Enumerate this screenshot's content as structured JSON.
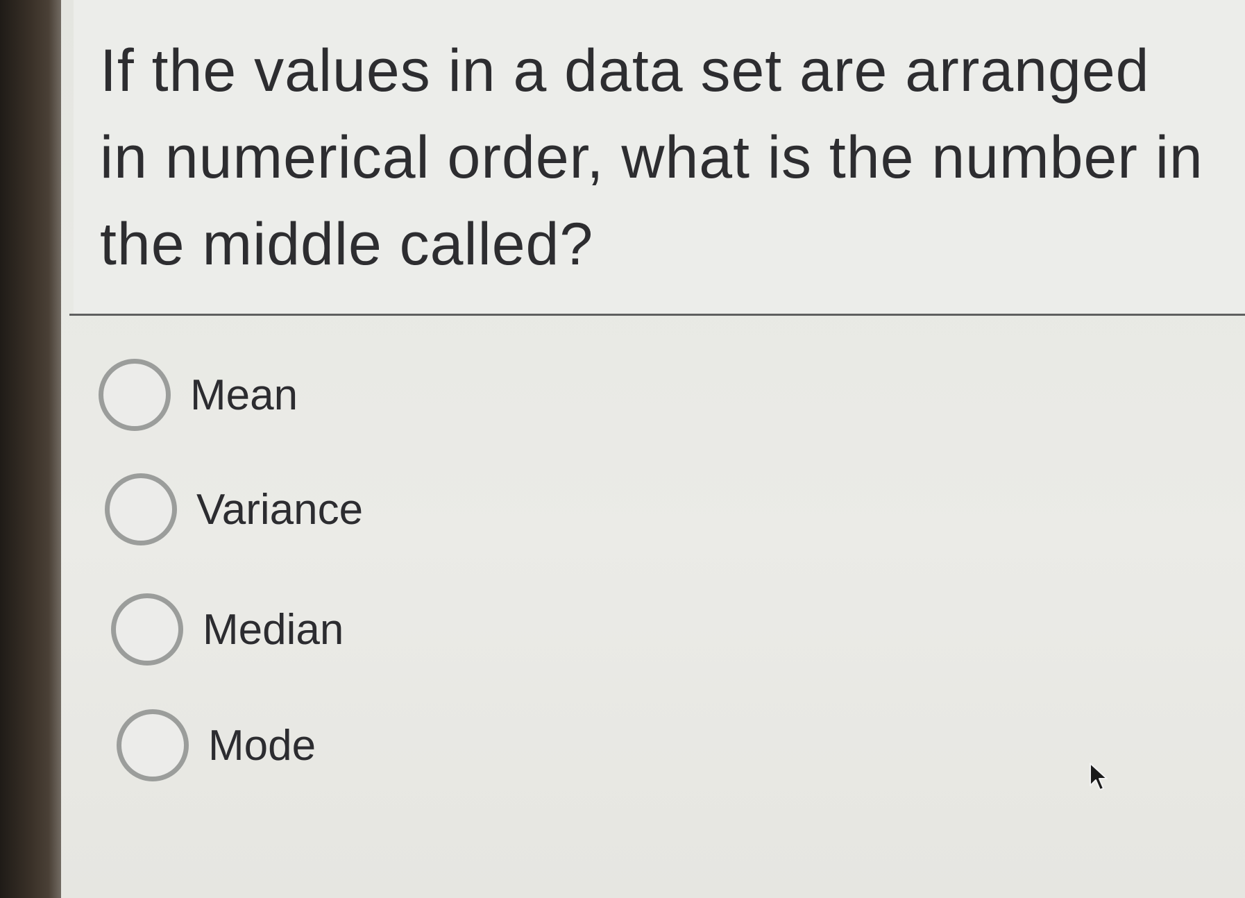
{
  "question": {
    "text": "If the values in a data set are arranged in numerical order, what is the number in the middle called?"
  },
  "options": [
    {
      "label": "Mean",
      "selected": false
    },
    {
      "label": "Variance",
      "selected": false
    },
    {
      "label": "Median",
      "selected": false
    },
    {
      "label": "Mode",
      "selected": false
    }
  ],
  "colors": {
    "text": "#2c2c30",
    "radio_border": "#9b9d9b",
    "background": "#ecedea"
  },
  "icons": {
    "radio": "radio-circle-icon",
    "cursor": "mouse-pointer-icon"
  }
}
